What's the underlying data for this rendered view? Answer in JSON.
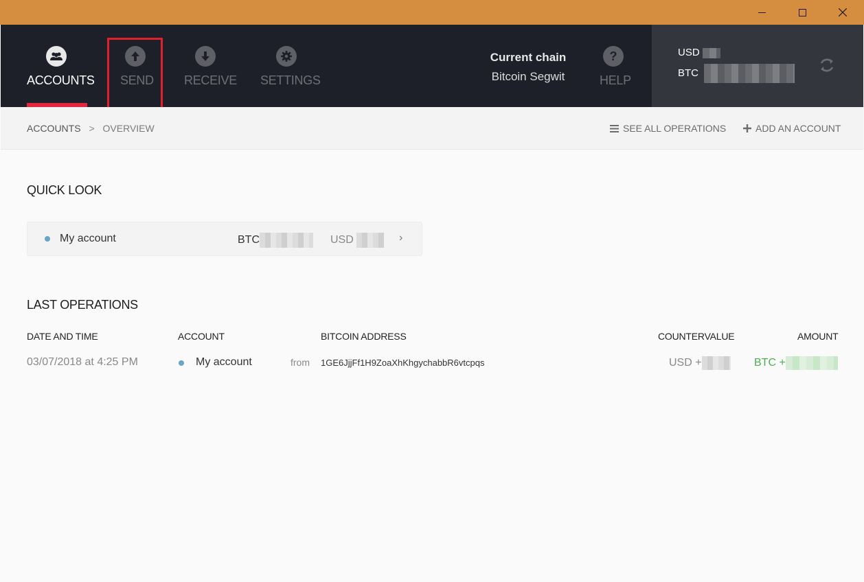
{
  "nav": {
    "items": [
      {
        "label": "ACCOUNTS",
        "icon": "accounts-icon",
        "active": true
      },
      {
        "label": "SEND",
        "icon": "send-arrow-up-icon",
        "active": false
      },
      {
        "label": "RECEIVE",
        "icon": "receive-arrow-down-icon",
        "active": false
      },
      {
        "label": "SETTINGS",
        "icon": "gear-icon",
        "active": false
      }
    ],
    "help_label": "HELP"
  },
  "chain": {
    "title": "Current chain",
    "value": "Bitcoin Segwit"
  },
  "balances": {
    "usd_label": "USD",
    "btc_label": "BTC"
  },
  "breadcrumb": {
    "root": "ACCOUNTS",
    "separator": ">",
    "current": "OVERVIEW"
  },
  "actions": {
    "see_all": "SEE ALL OPERATIONS",
    "add_account": "ADD AN ACCOUNT"
  },
  "quick_look": {
    "title": "QUICK LOOK",
    "account": {
      "name": "My account",
      "btc_label": "BTC",
      "usd_label": "USD",
      "chevron": "›"
    }
  },
  "last_operations": {
    "title": "LAST OPERATIONS",
    "columns": [
      "DATE AND TIME",
      "ACCOUNT",
      "BITCOIN ADDRESS",
      "COUNTERVALUE",
      "AMOUNT"
    ],
    "rows": [
      {
        "date": "03/07/2018 at 4:25 PM",
        "account": "My account",
        "direction": "from",
        "address": "1GE6JjjFf1H9ZoaXhKhgychabbR6vtcpqs",
        "countervalue_prefix": "USD +",
        "amount_prefix": "BTC +"
      }
    ]
  },
  "colors": {
    "titlebar": "#d58d3f",
    "appbar": "#1d2028",
    "accent_underline": "#e2263f",
    "send_highlight": "#e2202d",
    "account_dot": "#6aa5c6",
    "amount_green": "#4caf50"
  }
}
